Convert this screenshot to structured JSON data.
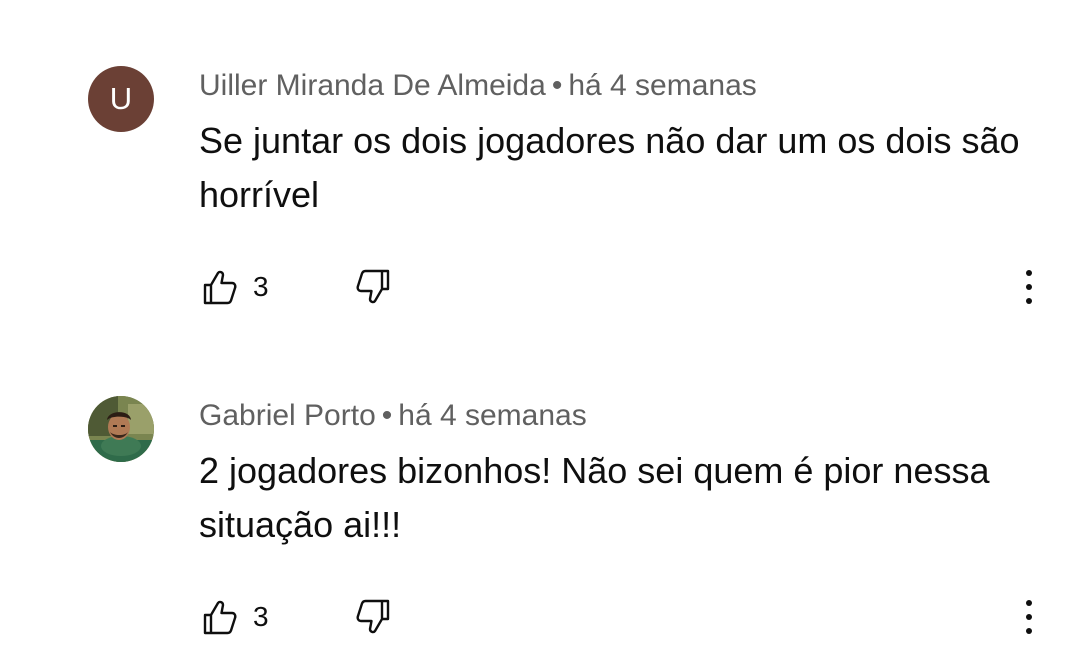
{
  "comments": [
    {
      "avatar_letter": "U",
      "author": "Uiller Miranda De Almeida",
      "separator": "•",
      "time": "há 4 semanas",
      "text": "Se juntar os dois jogadores não dar um os dois são horrível",
      "likes": "3",
      "avatar_color": "#6b4035"
    },
    {
      "avatar_letter": "",
      "author": "Gabriel Porto",
      "separator": "•",
      "time": "há 4 semanas",
      "text": "2 jogadores bizonhos! Não sei quem é pior nessa situação ai!!!",
      "likes": "3"
    }
  ],
  "icons": {
    "like": "thumb-up-icon",
    "dislike": "thumb-down-icon",
    "more": "more-vertical-icon"
  }
}
